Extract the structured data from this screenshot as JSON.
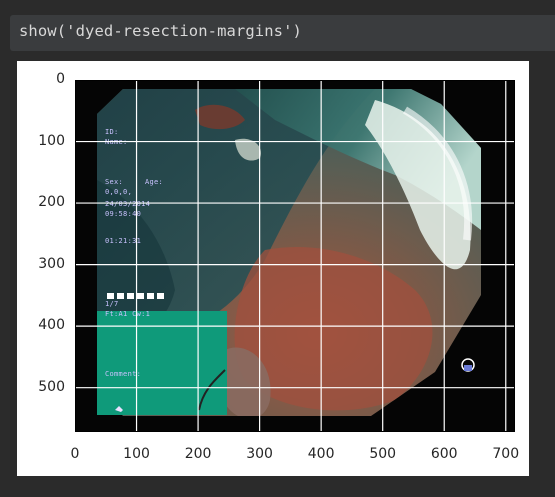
{
  "cell": {
    "code": "show('dyed-resection-margins')"
  },
  "image": {
    "osd": {
      "id_label": "ID:",
      "name_label": "Name:",
      "sex_label": "Sex:",
      "age_label": "Age:",
      "code": "0,0,0,",
      "date": "24/03/2014",
      "time": "09:58:40",
      "timer": "01:21:31",
      "frame": "1/7",
      "status": "Ft:A1 Cw:1",
      "comment_label": "Comment:"
    }
  },
  "axes": {
    "x_ticks": [
      "0",
      "100",
      "200",
      "300",
      "400",
      "500",
      "600",
      "700"
    ],
    "y_ticks": [
      "0",
      "100",
      "200",
      "300",
      "400",
      "500"
    ],
    "x_values": [
      0,
      100,
      200,
      300,
      400,
      500,
      600,
      700
    ],
    "y_values": [
      0,
      100,
      200,
      300,
      400,
      500
    ],
    "x_range": [
      0,
      715
    ],
    "y_range": [
      0,
      572
    ],
    "grid": true,
    "grid_color": "#ffffff"
  }
}
